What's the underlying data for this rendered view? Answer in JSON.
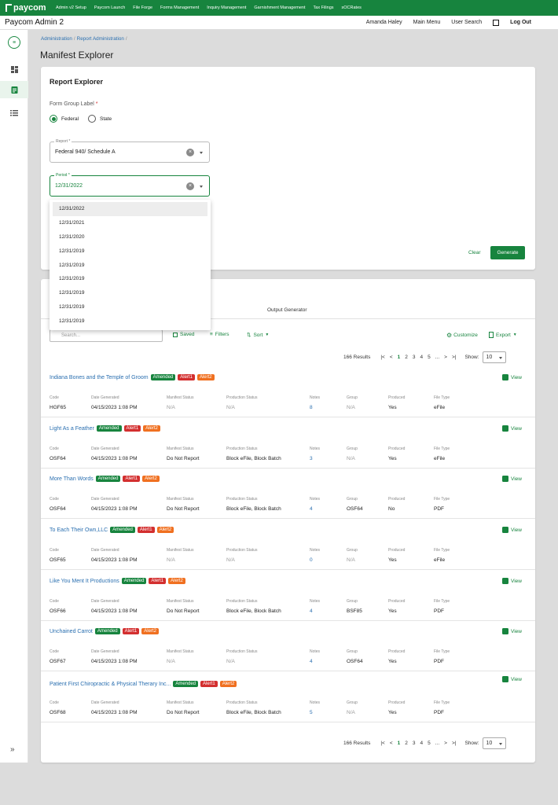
{
  "topnav": {
    "brand": "paycom",
    "items": [
      "Admin v2 Setup",
      "Paycom Launch",
      "File Forge",
      "Forms Management",
      "Inquiry Management",
      "Garnishment Management",
      "Tax Filings",
      "sOCRates"
    ]
  },
  "appbar": {
    "title": "Paycom Admin 2",
    "user": "Amanda Haley",
    "main_menu": "Main Menu",
    "user_search": "User Search",
    "logout": "Log Out"
  },
  "breadcrumb": [
    "Administration",
    "Report Administration"
  ],
  "page_title": "Manifest Explorer",
  "report_explorer": {
    "title": "Report Explorer",
    "form_group_label": "Form Group Label",
    "required_mark": "*",
    "radio_federal": "Federal",
    "radio_state": "State",
    "report_label": "Report *",
    "report_value": "Federal 940/ Schedule A",
    "period_label": "Period *",
    "period_value": "12/31/2022",
    "period_options": [
      "12/31/2022",
      "12/31/2021",
      "12/31/2020",
      "12/31/2019",
      "12/31/2019",
      "12/31/2019",
      "12/31/2019",
      "12/31/2019",
      "12/31/2019"
    ],
    "clear": "Clear",
    "generate": "Generate"
  },
  "results": {
    "tab": "Output Generator",
    "search_placeholder": "Search...",
    "saved": "Saved",
    "filters": "Filters",
    "sort": "Sort",
    "customize": "Customize",
    "export": "Export",
    "count": "166 Results",
    "pages": [
      "1",
      "2",
      "3",
      "4",
      "5",
      "..."
    ],
    "show_label": "Show:",
    "show_value": "10",
    "view": "View",
    "badges": [
      "Amended",
      "Alert1",
      "Alert2"
    ],
    "headers": [
      "Code",
      "Date Generated",
      "Manifest Status",
      "Production Status",
      "Notes",
      "Group",
      "Produced",
      "File Type"
    ],
    "rows": [
      {
        "title": "Indiana Bones and the Temple of Groom",
        "code": "HGF65",
        "date": "04/15/2023 1:08 PM",
        "manifest": "N/A",
        "production": "N/A",
        "notes": "8",
        "group": "N/A",
        "produced": "Yes",
        "filetype": "eFile"
      },
      {
        "title": "Light As a Feather",
        "code": "OSF64",
        "date": "04/15/2023 1:08 PM",
        "manifest": "Do Not Report",
        "production": "Block eFile, Block Batch",
        "notes": "3",
        "group": "N/A",
        "produced": "Yes",
        "filetype": "eFile"
      },
      {
        "title": "More Than Words",
        "code": "OSF64",
        "date": "04/15/2023 1:08 PM",
        "manifest": "Do Not Report",
        "production": "Block eFile, Block Batch",
        "notes": "4",
        "group": "OSF64",
        "produced": "No",
        "filetype": "PDF"
      },
      {
        "title": "To Each Their Own,LLC",
        "code": "OSF65",
        "date": "04/15/2023 1:08 PM",
        "manifest": "N/A",
        "production": "N/A",
        "notes": "0",
        "group": "N/A",
        "produced": "Yes",
        "filetype": "eFile"
      },
      {
        "title": "Like You Ment It Productions",
        "code": "OSF66",
        "date": "04/15/2023 1:08 PM",
        "manifest": "Do Not Report",
        "production": "Block eFile, Block Batch",
        "notes": "4",
        "group": "BSF85",
        "produced": "Yes",
        "filetype": "PDF"
      },
      {
        "title": "Unchained Carrot",
        "code": "OSF67",
        "date": "04/15/2023 1:08 PM",
        "manifest": "N/A",
        "production": "N/A",
        "notes": "4",
        "group": "OSF64",
        "produced": "Yes",
        "filetype": "PDF"
      },
      {
        "title": "Patient First Chiropractic & Physical Therary Inc...",
        "code": "OSF68",
        "date": "04/15/2023 1:08 PM",
        "manifest": "Do Not Report",
        "production": "Block eFile, Block Batch",
        "notes": "5",
        "group": "N/A",
        "produced": "Yes",
        "filetype": "PDF"
      }
    ]
  }
}
